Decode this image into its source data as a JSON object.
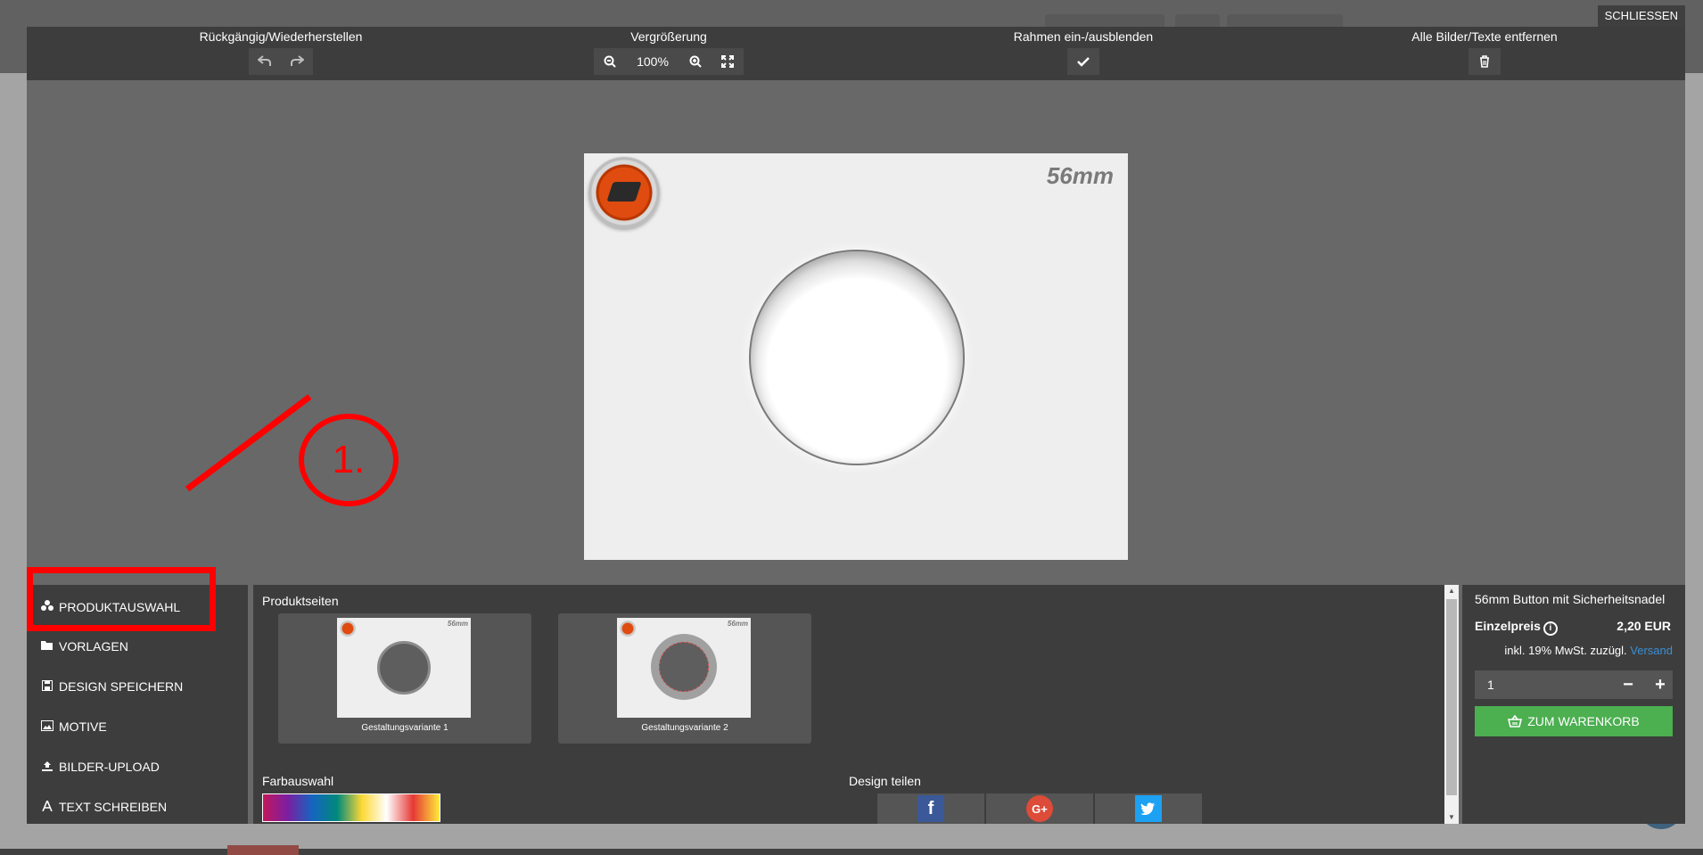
{
  "close_label": "SCHLIESSEN",
  "toolbar": {
    "undo_redo_label": "Rückgängig/Wiederherstellen",
    "zoom_label": "Vergrößerung",
    "zoom_value": "100%",
    "frame_label": "Rahmen ein-/ausblenden",
    "remove_all_label": "Alle Bilder/Texte entfernen"
  },
  "canvas": {
    "size_label": "56mm"
  },
  "annotation": {
    "label": "1."
  },
  "sidebar": {
    "items": [
      {
        "label": "PRODUKTAUSWAHL",
        "icon": "cubes-icon"
      },
      {
        "label": "VORLAGEN",
        "icon": "folder-icon"
      },
      {
        "label": "DESIGN SPEICHERN",
        "icon": "save-icon"
      },
      {
        "label": "MOTIVE",
        "icon": "image-icon"
      },
      {
        "label": "BILDER-UPLOAD",
        "icon": "upload-icon"
      },
      {
        "label": "TEXT SCHREIBEN",
        "icon": "text-icon"
      }
    ]
  },
  "products": {
    "title": "Produktseiten",
    "variants": [
      {
        "label": "Gestaltungsvariante 1",
        "thumb_size": "56mm"
      },
      {
        "label": "Gestaltungsvariante 2",
        "thumb_size": "56mm"
      }
    ],
    "color_title": "Farbauswahl",
    "share_title": "Design teilen"
  },
  "cart": {
    "product_name": "56mm Button mit Sicherheitsnadel",
    "price_label": "Einzelpreis",
    "price": "2,20 EUR",
    "tax_text": "inkl. 19% MwSt. zuzügl.",
    "shipping_link": "Versand",
    "quantity": "1",
    "add_to_cart": "ZUM WARENKORB"
  },
  "colors": {
    "modal_bg": "#686868",
    "panel_bg": "#3d3d3d",
    "accent_green": "#4caf50",
    "annotation_red": "#ff0000",
    "link_blue": "#3b8fd6"
  }
}
